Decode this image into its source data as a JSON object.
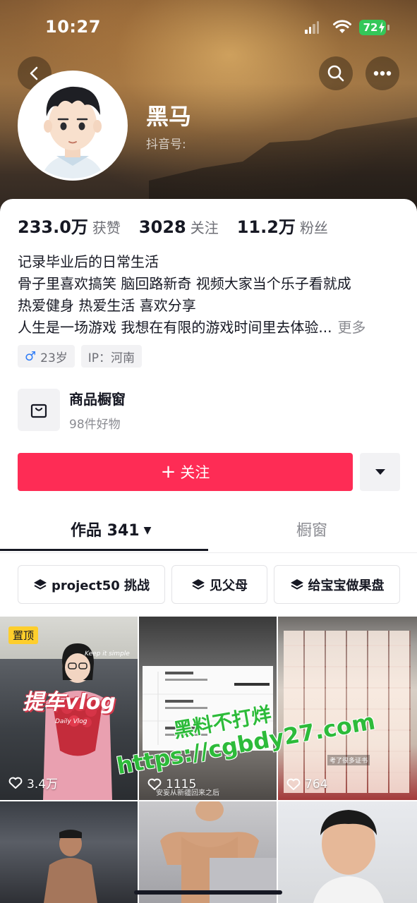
{
  "status_bar": {
    "time": "10:27",
    "battery": "72"
  },
  "profile": {
    "nickname": "黑马",
    "douyin_id_label": "抖音号:"
  },
  "stats": [
    {
      "value": "233.0万",
      "label": "获赞"
    },
    {
      "value": "3028",
      "label": "关注"
    },
    {
      "value": "11.2万",
      "label": "粉丝"
    }
  ],
  "bio": {
    "lines": [
      "记录毕业后的日常生活",
      "骨子里喜欢搞笑 脑回路新奇 视频大家当个乐子看就成",
      "热爱健身 热爱生活 喜欢分享",
      "人生是一场游戏 我想在有限的游戏时间里去体验..."
    ],
    "more": "更多"
  },
  "tags": {
    "age": "23岁",
    "ip": "IP：河南"
  },
  "shop": {
    "title": "商品橱窗",
    "subtitle": "98件好物"
  },
  "actions": {
    "follow": "关注"
  },
  "tabs": {
    "works": "作品 341",
    "window": "橱窗"
  },
  "collections": [
    "project50 挑战",
    "见父母",
    "给宝宝做果盘"
  ],
  "videos": [
    {
      "likes": "3.4万",
      "pinned": "置顶",
      "title": "提车vlog",
      "sub1": "Keep it simple",
      "sub2": "Daily Vlog"
    },
    {
      "likes": "1115",
      "caption": "安妄从新疆回来之后"
    },
    {
      "likes": "764",
      "caption": "考了很多证书"
    }
  ],
  "watermark": {
    "line1": "黑料不打烊",
    "line2": "https://cgbdy27.com"
  },
  "colors": {
    "accent": "#fe2c55",
    "pin": "#fece2c",
    "watermark": "#2dbb3a"
  }
}
